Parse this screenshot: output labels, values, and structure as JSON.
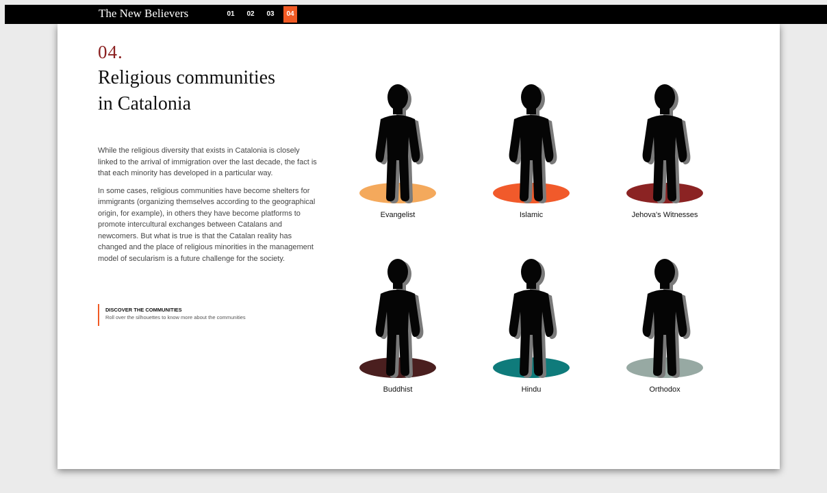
{
  "header": {
    "site_title": "The New Believers",
    "nav": [
      {
        "label": "01",
        "active": false
      },
      {
        "label": "02",
        "active": false
      },
      {
        "label": "03",
        "active": false
      },
      {
        "label": "04",
        "active": true
      }
    ],
    "accent_color": "#f15a24"
  },
  "section": {
    "number": "04.",
    "title_line1": "Religious communities",
    "title_line2": "in Catalonia",
    "paragraphs": [
      "While the religious diversity that exists in Catalonia is closely linked to the arrival of immigration over the last decade, the fact is that each minority has developed in a particular way.",
      "In some cases, religious communities have become shelters for immigrants (organizing themselves according to the geographical origin, for example), in others they have become platforms to promote intercultural exchanges between Catalans and newcomers. But what is true is that the Catalan reality has changed and the place of religious minorities in the management model of secularism is a future challenge for the society."
    ],
    "callout": {
      "title": "DISCOVER THE COMMUNITIES",
      "text": "Roll over the silhouettes to know more about the communities"
    }
  },
  "communities": [
    {
      "label": "Evangelist",
      "color": "#f4a95c",
      "icon": "person-silhouette-icon"
    },
    {
      "label": "Islamic",
      "color": "#f15a2b",
      "icon": "person-silhouette-icon"
    },
    {
      "label": "Jehova's Witnesses",
      "color": "#8b2323",
      "icon": "person-silhouette-icon"
    },
    {
      "label": "Buddhist",
      "color": "#4a1f1f",
      "icon": "person-silhouette-icon"
    },
    {
      "label": "Hindu",
      "color": "#0f7b7b",
      "icon": "person-silhouette-icon"
    },
    {
      "label": "Orthodox",
      "color": "#97a9a3",
      "icon": "person-silhouette-icon"
    }
  ]
}
